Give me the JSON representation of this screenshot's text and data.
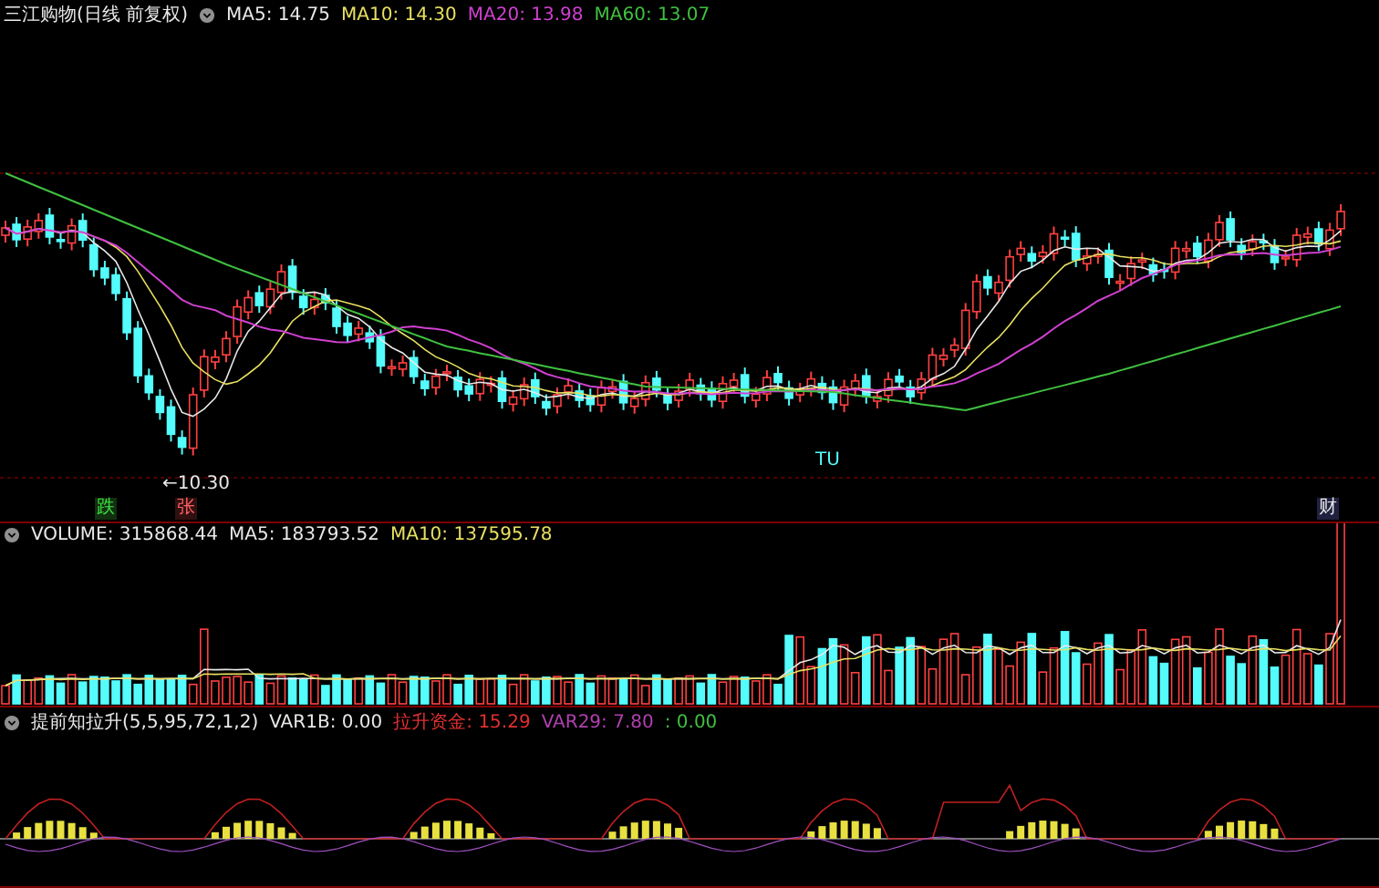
{
  "price_panel": {
    "title": "三江购物(日线 前复权)",
    "indicators": [
      {
        "label": "MA5: 14.75",
        "color": "#e8e8e8"
      },
      {
        "label": "MA10: 14.30",
        "color": "#e8e060"
      },
      {
        "label": "MA20: 13.98",
        "color": "#d040d0"
      },
      {
        "label": "MA60: 13.07",
        "color": "#40c040"
      }
    ],
    "markers": [
      {
        "text": "TU",
        "kind": "note"
      },
      {
        "text": "←10.30",
        "kind": "low"
      },
      {
        "text": "跌",
        "kind": "fall"
      },
      {
        "text": "张",
        "kind": "rise"
      },
      {
        "text": "财",
        "kind": "report"
      }
    ]
  },
  "volume_panel": {
    "indicators": [
      {
        "label": "VOLUME: 315868.44",
        "color": "#e8e8e8"
      },
      {
        "label": "MA5: 183793.52",
        "color": "#e8e8e8"
      },
      {
        "label": "MA10: 137595.78",
        "color": "#e8e060"
      }
    ]
  },
  "signal_panel": {
    "title": "提前知拉升(5,5,95,72,1,2)",
    "indicators": [
      {
        "label": "VAR1B: 0.00",
        "color": "#e8e8e8"
      },
      {
        "label": "拉升资金: 15.29",
        "color": "#e03030"
      },
      {
        "label": "VAR29: 7.80",
        "color": "#b040b0"
      },
      {
        "label": ": 0.00",
        "color": "#40c040"
      }
    ]
  }
}
